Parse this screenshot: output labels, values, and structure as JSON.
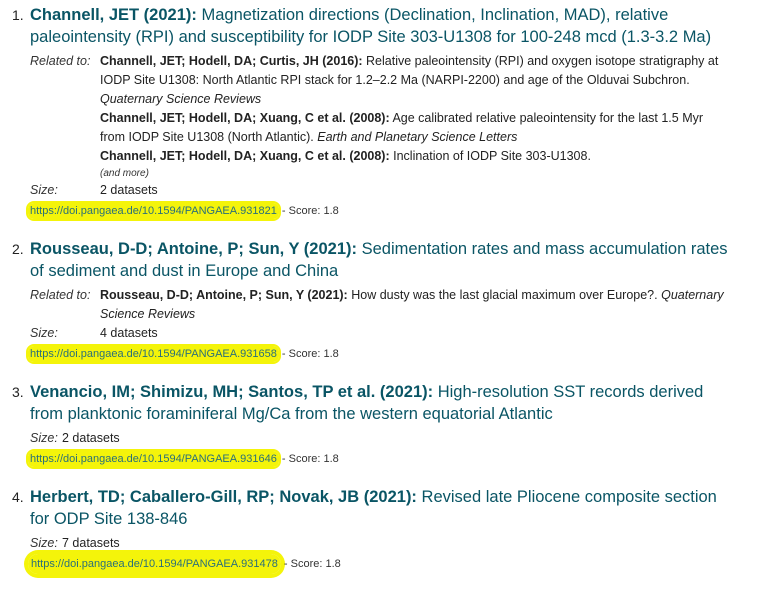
{
  "results": [
    {
      "number": "1.",
      "authors": "Channell, JET (2021):",
      "title": "Magnetization directions (Declination, Inclination, MAD), relative paleointensity (RPI) and susceptibility for IODP Site 303-U1308 for 100-248 mcd (1.3-3.2 Ma)",
      "related_label": "Related to:",
      "related": [
        {
          "authors": "Channell, JET; Hodell, DA; Curtis, JH (2016):",
          "text": "Relative paleointensity (RPI) and oxygen isotope stratigraphy at IODP Site U1308: North Atlantic RPI stack for 1.2–2.2 Ma (NARPI-2200) and age of the Olduvai Subchron.",
          "journal": "Quaternary Science Reviews"
        },
        {
          "authors": "Channell, JET; Hodell, DA; Xuang, C et al. (2008):",
          "text": "Age calibrated relative paleointensity for the last 1.5 Myr from IODP Site U1308 (North Atlantic).",
          "journal": "Earth and Planetary Science Letters"
        },
        {
          "authors": "Channell, JET; Hodell, DA; Xuang, C et al. (2008):",
          "text": "Inclination of IODP Site 303-U1308.",
          "journal": ""
        }
      ],
      "more": "(and more)",
      "size_label": "Size:",
      "size": "2 datasets",
      "doi": "https://doi.pangaea.de/10.1594/PANGAEA.931821",
      "score": " - Score: 1.8"
    },
    {
      "number": "2.",
      "authors": "Rousseau, D-D; Antoine, P; Sun, Y (2021):",
      "title": "Sedimentation rates and mass accumulation rates of sediment and dust in Europe and China",
      "related_label": "Related to:",
      "related": [
        {
          "authors": "Rousseau, D-D; Antoine, P; Sun, Y (2021):",
          "text": "How dusty was the last glacial maximum over Europe?.",
          "journal": "Quaternary Science Reviews"
        }
      ],
      "size_label": "Size:",
      "size": "4 datasets",
      "doi": "https://doi.pangaea.de/10.1594/PANGAEA.931658",
      "score": " - Score: 1.8"
    },
    {
      "number": "3.",
      "authors": "Venancio, IM; Shimizu, MH; Santos, TP et al. (2021):",
      "title": "High-resolution SST records derived from planktonic foraminiferal Mg/Ca from the western equatorial Atlantic",
      "size_label": "Size:",
      "size": "2 datasets",
      "doi": "https://doi.pangaea.de/10.1594/PANGAEA.931646",
      "score": " - Score: 1.8"
    },
    {
      "number": "4.",
      "authors": "Herbert, TD; Caballero-Gill, RP; Novak, JB (2021):",
      "title": "Revised late Pliocene composite section for ODP Site 138-846",
      "size_label": "Size:",
      "size": "7 datasets",
      "doi": "https://doi.pangaea.de/10.1594/PANGAEA.931478",
      "score": " - Score: 1.8"
    }
  ],
  "colors": {
    "title": "#0a5565",
    "highlight": "#f4f40a",
    "doi": "#2a6f7a"
  }
}
